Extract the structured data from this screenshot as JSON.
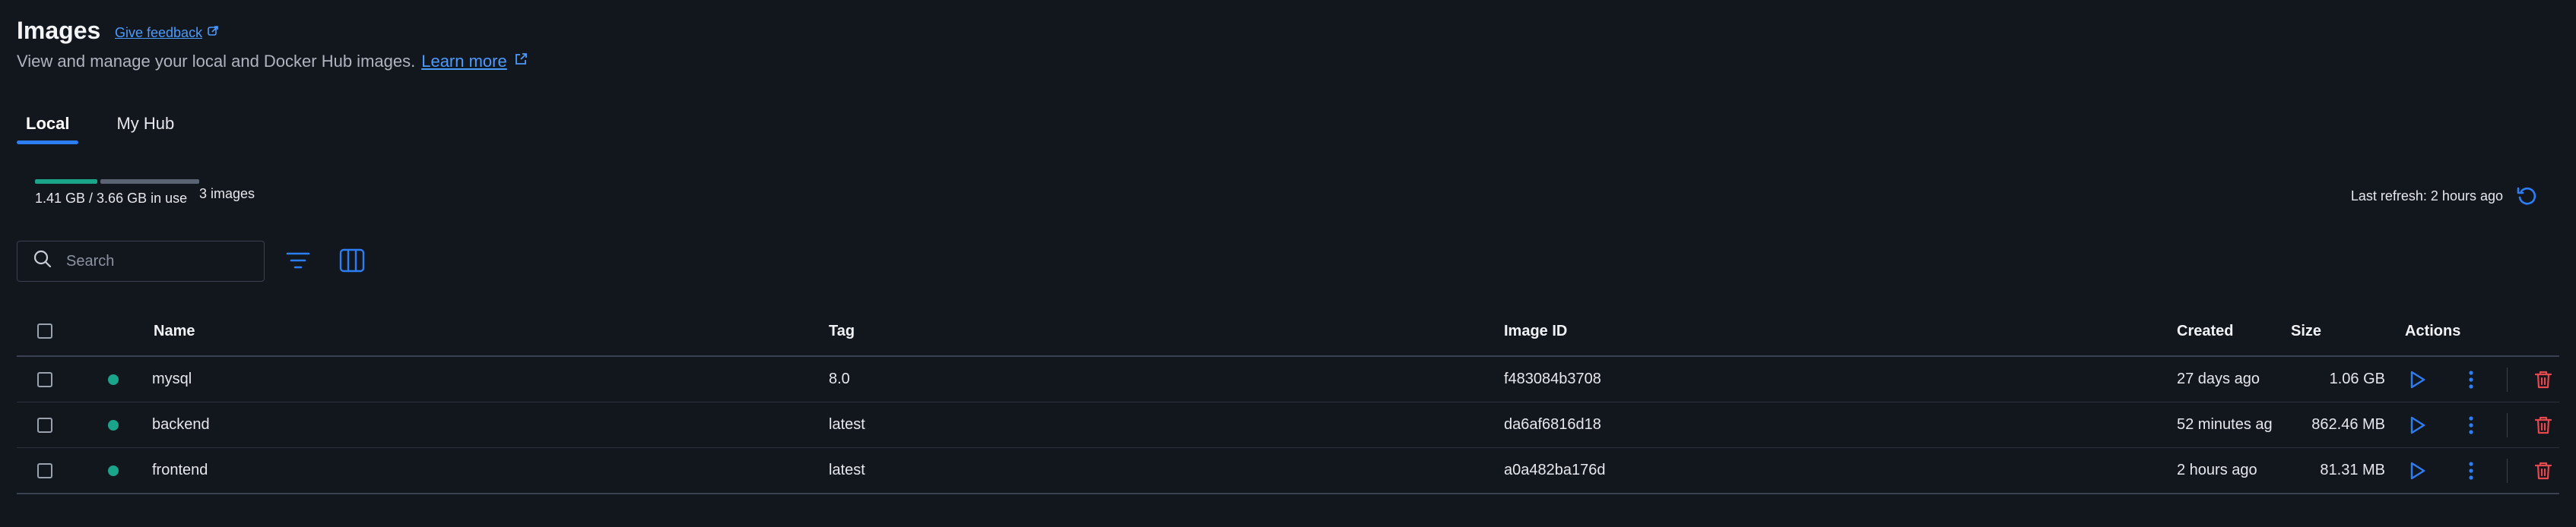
{
  "header": {
    "title": "Images",
    "feedback_label": "Give feedback",
    "subtitle": "View and manage your local and Docker Hub images.",
    "learn_more": "Learn more"
  },
  "tabs": [
    {
      "label": "Local",
      "active": true
    },
    {
      "label": "My Hub",
      "active": false
    }
  ],
  "usage": {
    "text": "1.41 GB / 3.66 GB in use",
    "used_fraction": 0.385,
    "images_count": "3 images",
    "used_color": "#1aa58a",
    "free_color": "#5b6472"
  },
  "refresh": {
    "label": "Last refresh: 2 hours ago"
  },
  "search": {
    "placeholder": "Search",
    "value": ""
  },
  "table": {
    "columns": [
      "Name",
      "Tag",
      "Image ID",
      "Created",
      "Size",
      "Actions"
    ],
    "rows": [
      {
        "name": "mysql",
        "tag": "8.0",
        "image_id": "f483084b3708",
        "created": "27 days ago",
        "size": "1.06 GB",
        "in_use": true
      },
      {
        "name": "backend",
        "tag": "latest",
        "image_id": "da6af6816d18",
        "created": "52 minutes ag",
        "size": "862.46 MB",
        "in_use": true
      },
      {
        "name": "frontend",
        "tag": "latest",
        "image_id": "a0a482ba176d",
        "created": "2 hours ago",
        "size": "81.31 MB",
        "in_use": true
      }
    ]
  },
  "colors": {
    "accent": "#2d7ef5",
    "link": "#4b9bff",
    "delete": "#e5484d",
    "status_dot": "#1aa58a"
  },
  "icons": {
    "feedback": "external-feedback-icon",
    "learn_more": "external-link-icon",
    "refresh": "refresh-icon",
    "search": "search-icon",
    "filter": "filter-icon",
    "columns": "columns-icon",
    "run": "play-icon",
    "more": "kebab-menu-icon",
    "delete": "trash-icon"
  }
}
